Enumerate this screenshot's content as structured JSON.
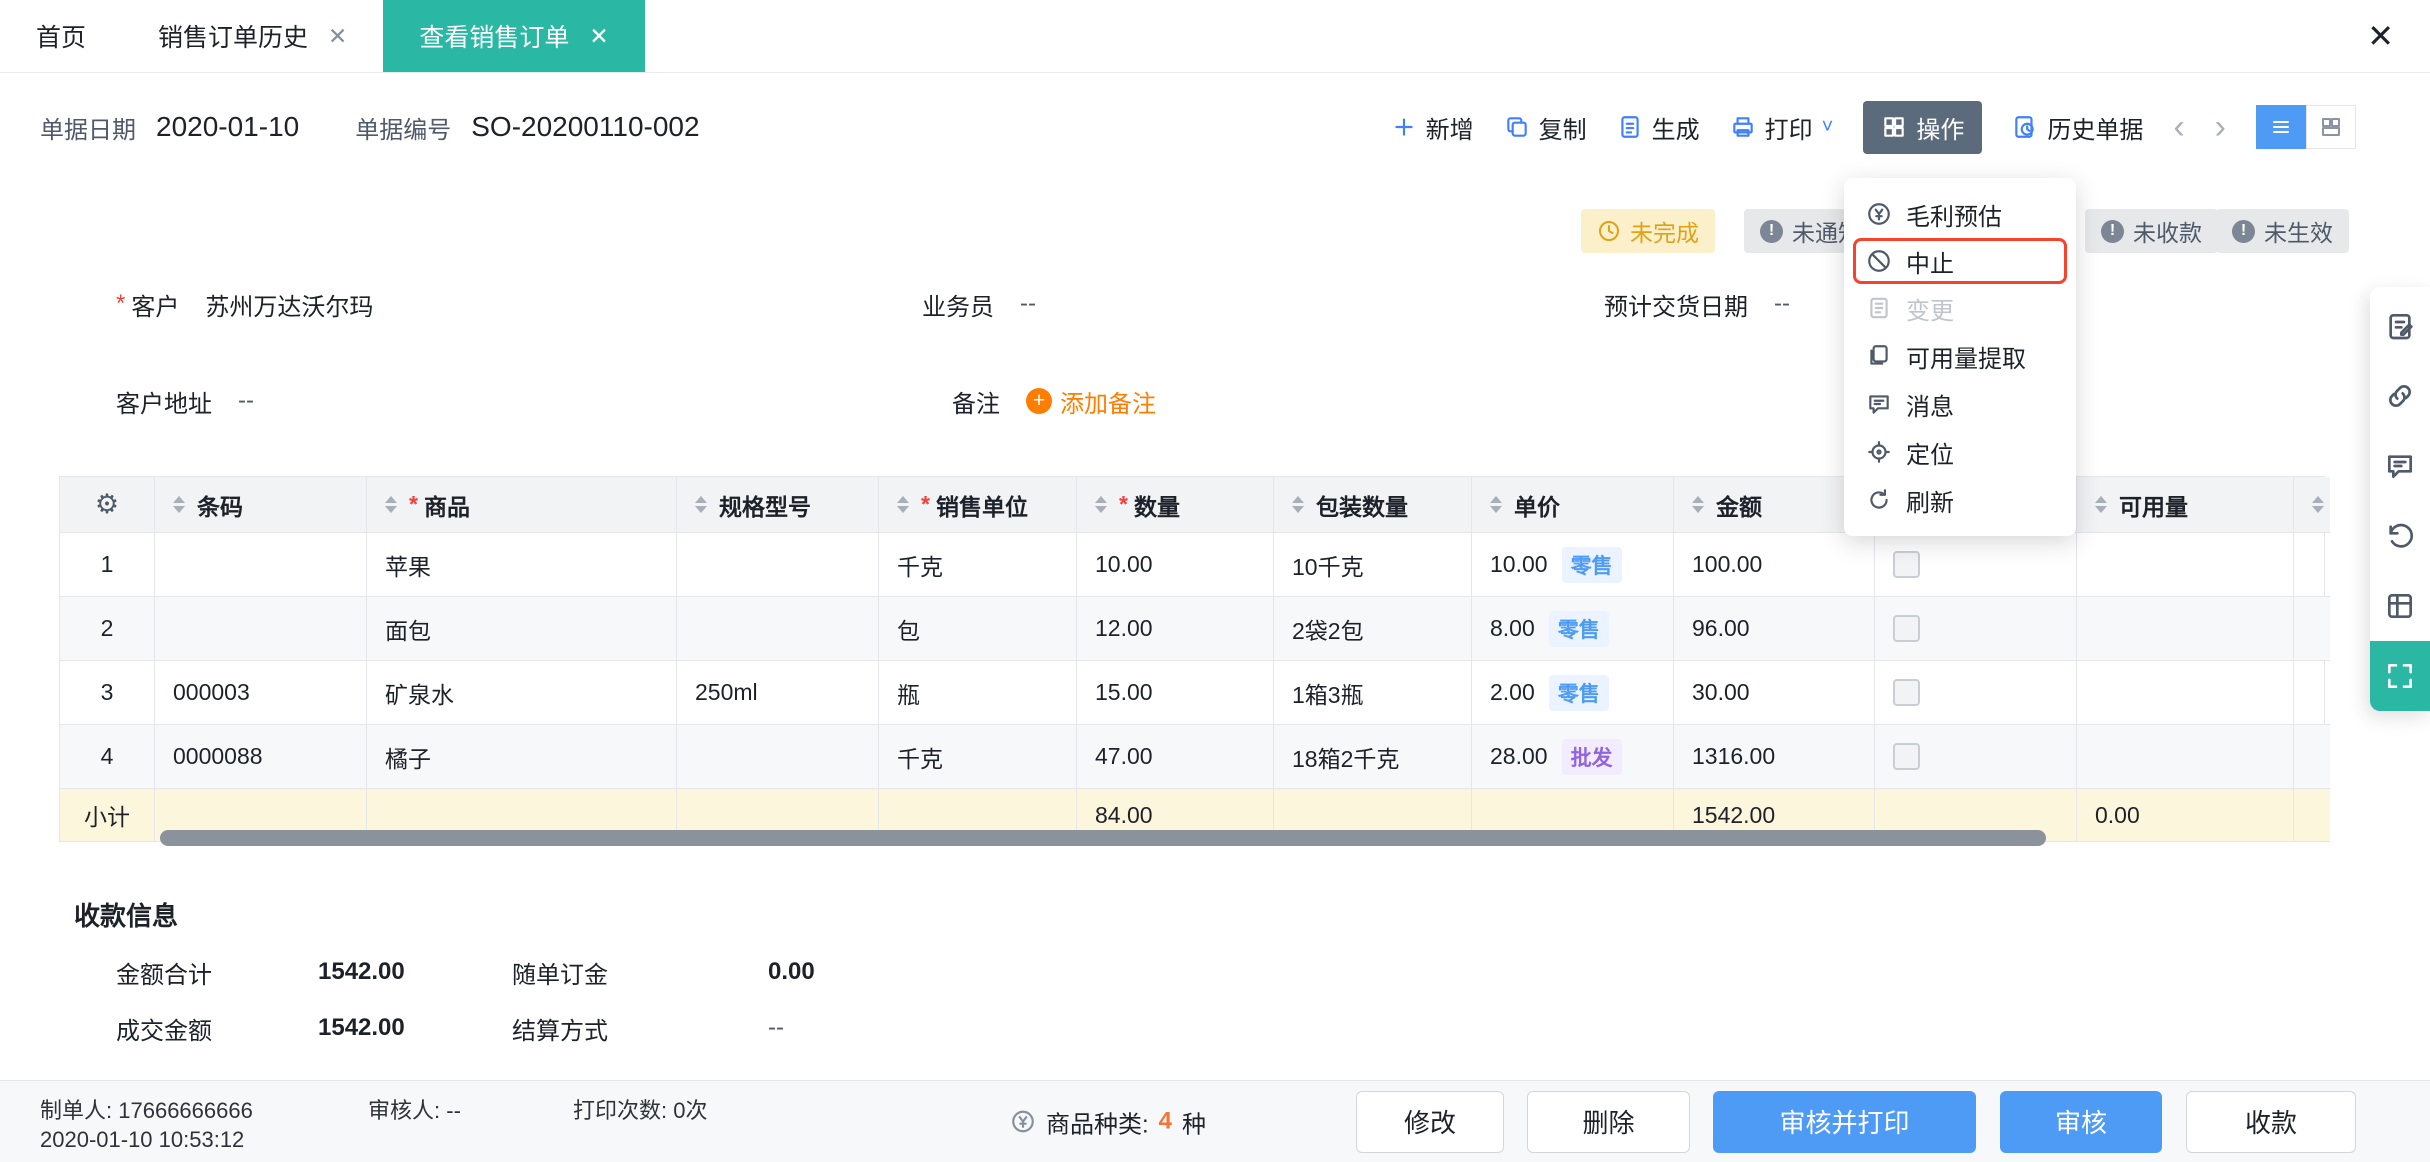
{
  "misc": {
    "star": "*",
    "close": "✕",
    "chev_left": "‹",
    "chev_right": "›",
    "gear": "⚙",
    "chev_down": "˅"
  },
  "tabs": {
    "home": "首页",
    "history": "销售订单历史",
    "active": "查看销售订单"
  },
  "doc": {
    "date_label": "单据日期",
    "date_value": "2020-01-10",
    "no_label": "单据编号",
    "no_value": "SO-20200110-002"
  },
  "toolbar": {
    "add": "新增",
    "copy": "复制",
    "generate": "生成",
    "print": "打印",
    "operate": "操作",
    "history": "历史单据"
  },
  "badges": {
    "incomplete": "未完成",
    "not_notified": "未通知",
    "not_received": "未收款",
    "not_effective": "未生效"
  },
  "menu": {
    "items": [
      {
        "label": "毛利预估"
      },
      {
        "label": "中止"
      },
      {
        "label": "变更"
      },
      {
        "label": "可用量提取"
      },
      {
        "label": "消息"
      },
      {
        "label": "定位"
      },
      {
        "label": "刷新"
      }
    ]
  },
  "form": {
    "customer_label": "客户",
    "customer_value": "苏州万达沃尔玛",
    "salesman_label": "业务员",
    "salesman_value": "--",
    "delivery_label": "预计交货日期",
    "delivery_value": "--",
    "address_label": "客户地址",
    "address_value": "--",
    "remark_label": "备注",
    "add_remark": "添加备注"
  },
  "table": {
    "columns": {
      "barcode": "条码",
      "product": "商品",
      "spec": "规格型号",
      "unit": "销售单位",
      "qty": "数量",
      "pkg": "包装数量",
      "price": "单价",
      "amount": "金额",
      "available": "可用量"
    },
    "rows": [
      {
        "seq": "1",
        "barcode": "",
        "product": "苹果",
        "spec": "",
        "unit": "千克",
        "qty": "10.00",
        "pkg": "10千克",
        "price": "10.00",
        "price_tag": "零售",
        "amount": "100.00",
        "available": ""
      },
      {
        "seq": "2",
        "barcode": "",
        "product": "面包",
        "spec": "",
        "unit": "包",
        "qty": "12.00",
        "pkg": "2袋2包",
        "price": "8.00",
        "price_tag": "零售",
        "amount": "96.00",
        "available": ""
      },
      {
        "seq": "3",
        "barcode": "000003",
        "product": "矿泉水",
        "spec": "250ml",
        "unit": "瓶",
        "qty": "15.00",
        "pkg": "1箱3瓶",
        "price": "2.00",
        "price_tag": "零售",
        "amount": "30.00",
        "available": ""
      },
      {
        "seq": "4",
        "barcode": "0000088",
        "product": "橘子",
        "spec": "",
        "unit": "千克",
        "qty": "47.00",
        "pkg": "18箱2千克",
        "price": "28.00",
        "price_tag": "批发",
        "amount": "1316.00",
        "available": ""
      }
    ],
    "subtotal": {
      "label": "小计",
      "qty": "84.00",
      "amount": "1542.00",
      "available": "0.00"
    }
  },
  "payment": {
    "title": "收款信息",
    "total_label": "金额合计",
    "total_value": "1542.00",
    "deposit_label": "随单订金",
    "deposit_value": "0.00",
    "deal_label": "成交金额",
    "deal_value": "1542.00",
    "settle_label": "结算方式",
    "settle_value": "--"
  },
  "footer": {
    "creator_label": "制单人:",
    "creator_value": "17666666666",
    "created_at": "2020-01-10 10:53:12",
    "auditor_label": "审核人:",
    "auditor_value": "--",
    "print_count_label": "打印次数:",
    "print_count_value": "0次",
    "category_label": "商品种类:",
    "category_count": "4",
    "category_unit": "种",
    "modify": "修改",
    "delete": "删除",
    "audit_print": "审核并打印",
    "audit": "审核",
    "receive": "收款"
  }
}
